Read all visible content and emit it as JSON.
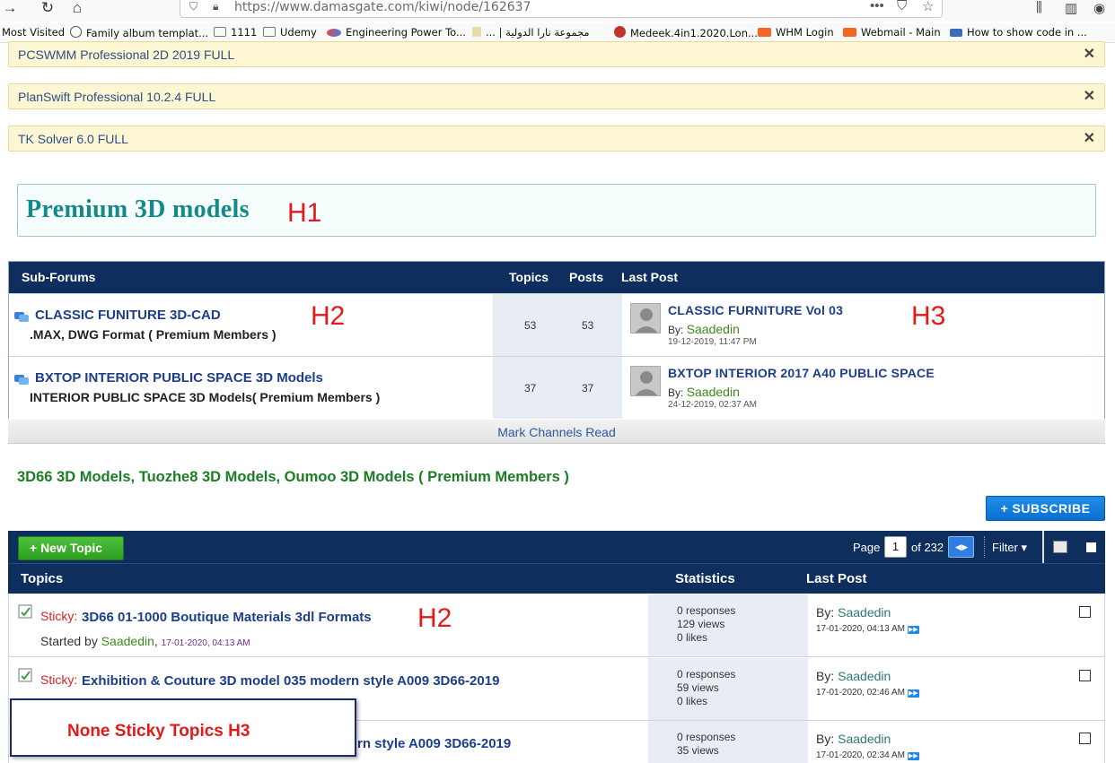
{
  "browser": {
    "url": "https://www.damasgate.com/kiwi/node/162637",
    "bookmarks": [
      {
        "label": "Most Visited",
        "color": ""
      },
      {
        "label": "Family album templat...",
        "color": "#555555"
      },
      {
        "label": "1111",
        "color": "#8a8a8a"
      },
      {
        "label": "Udemy",
        "color": "#8a8a8a"
      },
      {
        "label": "Engineering Power To...",
        "color": "#e04a4a"
      },
      {
        "label": "... | مجموعة نارا الدولية",
        "color": "#d7c48a"
      },
      {
        "label": "Medeek.4in1.2020.Lon...",
        "color": "#c0322c"
      },
      {
        "label": "WHM Login",
        "color": "#f26722"
      },
      {
        "label": "Webmail - Main",
        "color": "#f26722"
      },
      {
        "label": "How to show code in ...",
        "color": "#3a6fb5"
      }
    ]
  },
  "notices": [
    {
      "text": "PCSWMM Professional 2D 2019 FULL",
      "close": "✕"
    },
    {
      "text": "PlanSwift Professional 10.2.4 FULL",
      "close": "✕"
    },
    {
      "text": "TK Solver 6.0 FULL",
      "close": "✕"
    }
  ],
  "premium": {
    "title": "Premium 3D models",
    "annotation": "H1"
  },
  "subforums": {
    "headers": {
      "name": "Sub-Forums",
      "topics": "Topics",
      "posts": "Posts",
      "last_post": "Last Post"
    },
    "rows": [
      {
        "title": "CLASSIC FUNITURE 3D-CAD",
        "desc": ".MAX, DWG Format ( Premium Members )",
        "annotation": "H2",
        "topics": "53",
        "posts": "53",
        "last_title": "CLASSIC FURNITURE Vol 03",
        "last_annotation": "H3",
        "by": "By:",
        "user": "Saadedin",
        "date": "19-12-2019, 11:47 PM"
      },
      {
        "title": "BXTOP INTERIOR PUBLIC SPACE 3D Models",
        "desc": "INTERIOR PUBLIC SPACE 3D Models( Premium Members )",
        "annotation": "",
        "topics": "37",
        "posts": "37",
        "last_title": "BXTOP INTERIOR 2017 A40 PUBLIC SPACE",
        "last_annotation": "",
        "by": "By:",
        "user": "Saadedin",
        "date": "24-12-2019, 02:37 AM"
      }
    ],
    "mark_read": "Mark Channels Read"
  },
  "channel": {
    "title": "3D66 3D Models, Tuozhe8 3D Models, Oumoo 3D Models ( Premium Members )"
  },
  "subscribe_label": "+ SUBSCRIBE",
  "topics_bar": {
    "new_topic": "+ New Topic",
    "page_label": "Page",
    "page_value": "1",
    "of_label": "of 232",
    "filter_label": "Filter ▾"
  },
  "topics": {
    "headers": {
      "topics": "Topics",
      "stats": "Statistics",
      "last_post": "Last Post"
    },
    "rows": [
      {
        "sticky": "Sticky:",
        "title": "3D66 01-1000 Boutique Materials 3dl Formats",
        "annotation": "H2",
        "started_label": "Started by",
        "user": "Saadedin",
        "start_date": "17-01-2020, 04:13 AM",
        "responses": "0 responses",
        "views": "129 views",
        "likes": "0 likes",
        "by": "By:",
        "last_user": "Saadedin",
        "last_date": "17-01-2020, 04:13 AM"
      },
      {
        "sticky": "Sticky:",
        "title": "Exhibition & Couture 3D model 035 modern style A009 3D66-2019",
        "annotation": "",
        "started_label": "",
        "user": "",
        "start_date": "",
        "responses": "0 responses",
        "views": "59 views",
        "likes": "0 likes",
        "by": "By:",
        "last_user": "Saadedin",
        "last_date": "17-01-2020, 02:46 AM"
      },
      {
        "sticky": "",
        "title": "rn style A009 3D66-2019",
        "annotation": "",
        "started_label": "",
        "user": "",
        "start_date": "",
        "responses": "0 responses",
        "views": "35 views",
        "likes": "",
        "by": "By:",
        "last_user": "Saadedin",
        "last_date": "17-01-2020, 02:34 AM"
      }
    ]
  },
  "overlay_note": "None Sticky Topics H3",
  "colors": {
    "header_navy": "#0e2f5e",
    "link_blue": "#1d3f8a",
    "user_green": "#3c8a1d",
    "annotation_red": "#e21a1a",
    "teal_title": "#138a87"
  }
}
